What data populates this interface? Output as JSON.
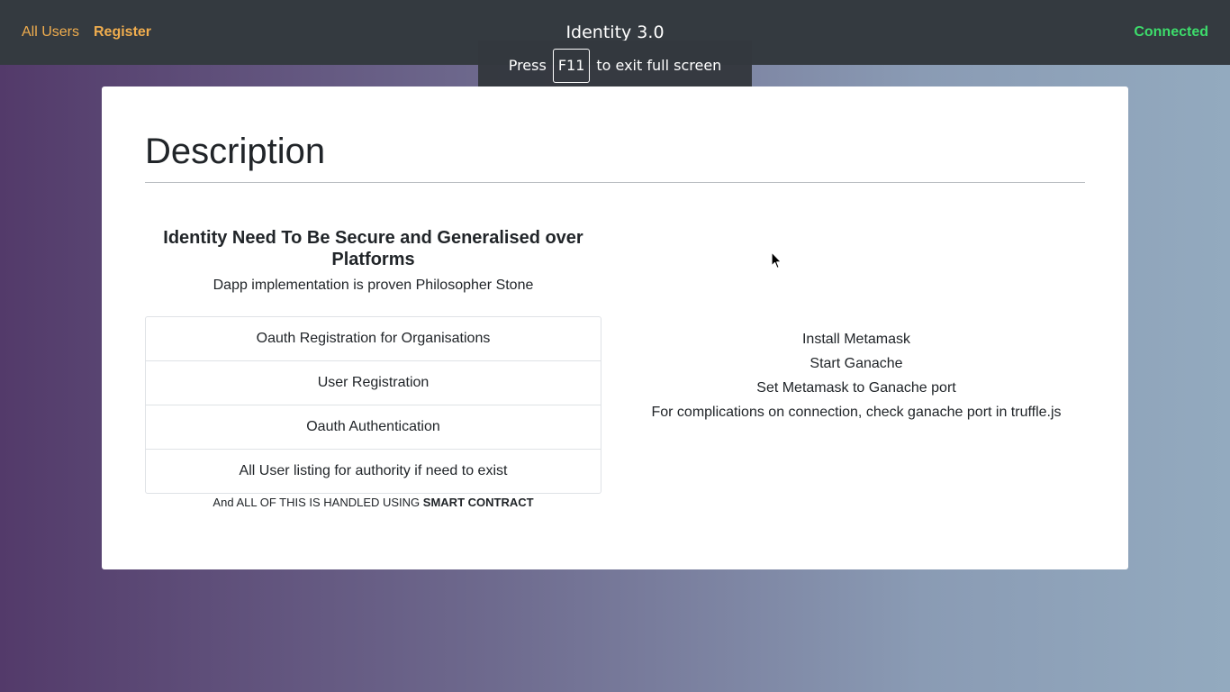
{
  "navbar": {
    "links": [
      {
        "label": "All Users"
      },
      {
        "label": "Register"
      }
    ],
    "brand": "Identity 3.0",
    "status": "Connected",
    "status_color": "#3ddc6b",
    "link_color": "#f0ad4e"
  },
  "fullscreen_notice": {
    "prefix": "Press",
    "key": "F11",
    "suffix": "to exit full screen"
  },
  "main": {
    "title": "Description",
    "heading": "Identity Need To Be Secure and Generalised over Platforms",
    "subtitle": "Dapp implementation is proven Philosopher Stone",
    "features": [
      "Oauth Registration for Organisations",
      "User Registration",
      "Oauth Authentication",
      "All User listing for authority if need to exist"
    ],
    "footnote": {
      "text": "And ALL OF THIS IS HANDLED USING",
      "strong": "SMART CONTRACT"
    },
    "steps": [
      "Install Metamask",
      "Start Ganache",
      "Set Metamask to Ganache port",
      "For complications on connection, check ganache port in truffle.js"
    ]
  },
  "icons": {
    "cursor": "mouse-pointer-icon"
  }
}
